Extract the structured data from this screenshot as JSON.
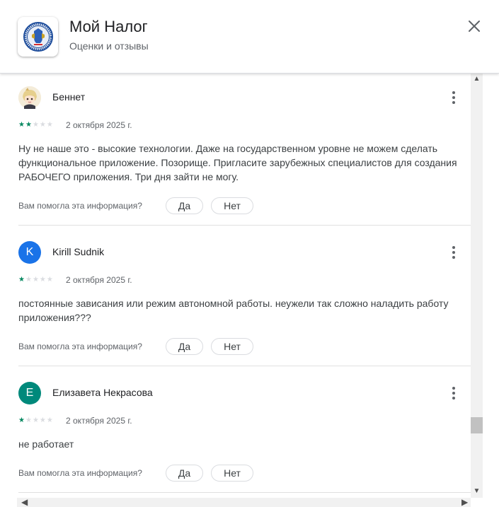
{
  "header": {
    "title": "Мой Налог",
    "subtitle": "Оценки и отзывы",
    "app_icon": "fns-emblem-icon",
    "close_icon": "close-icon"
  },
  "helpful": {
    "question": "Вам помогла эта информация?",
    "yes": "Да",
    "no": "Нет"
  },
  "reviews": [
    {
      "author": "Беннет",
      "avatar_type": "image",
      "stars": 2,
      "date": "2 октября 2025 г.",
      "text": "Ну не наше это - высокие технологии. Даже на государственном уровне не можем сделать функциональное приложение. Позорище. Пригласите зарубежных специалистов для создания РАБОЧЕГО приложения. Три дня зайти не могу."
    },
    {
      "author": "Kirill Sudnik",
      "avatar_letter": "K",
      "avatar_color": "#1a73e8",
      "stars": 1,
      "date": "2 октября 2025 г.",
      "text": "постоянные зависания или режим автономной работы. неужели так сложно наладить работу приложения???"
    },
    {
      "author": "Елизавета Некрасова",
      "avatar_letter": "E",
      "avatar_color": "#00897b",
      "stars": 1,
      "date": "2 октября 2025 г.",
      "text": "не работает"
    }
  ],
  "colors": {
    "star_on": "#01875f",
    "star_off": "#dadce0"
  }
}
